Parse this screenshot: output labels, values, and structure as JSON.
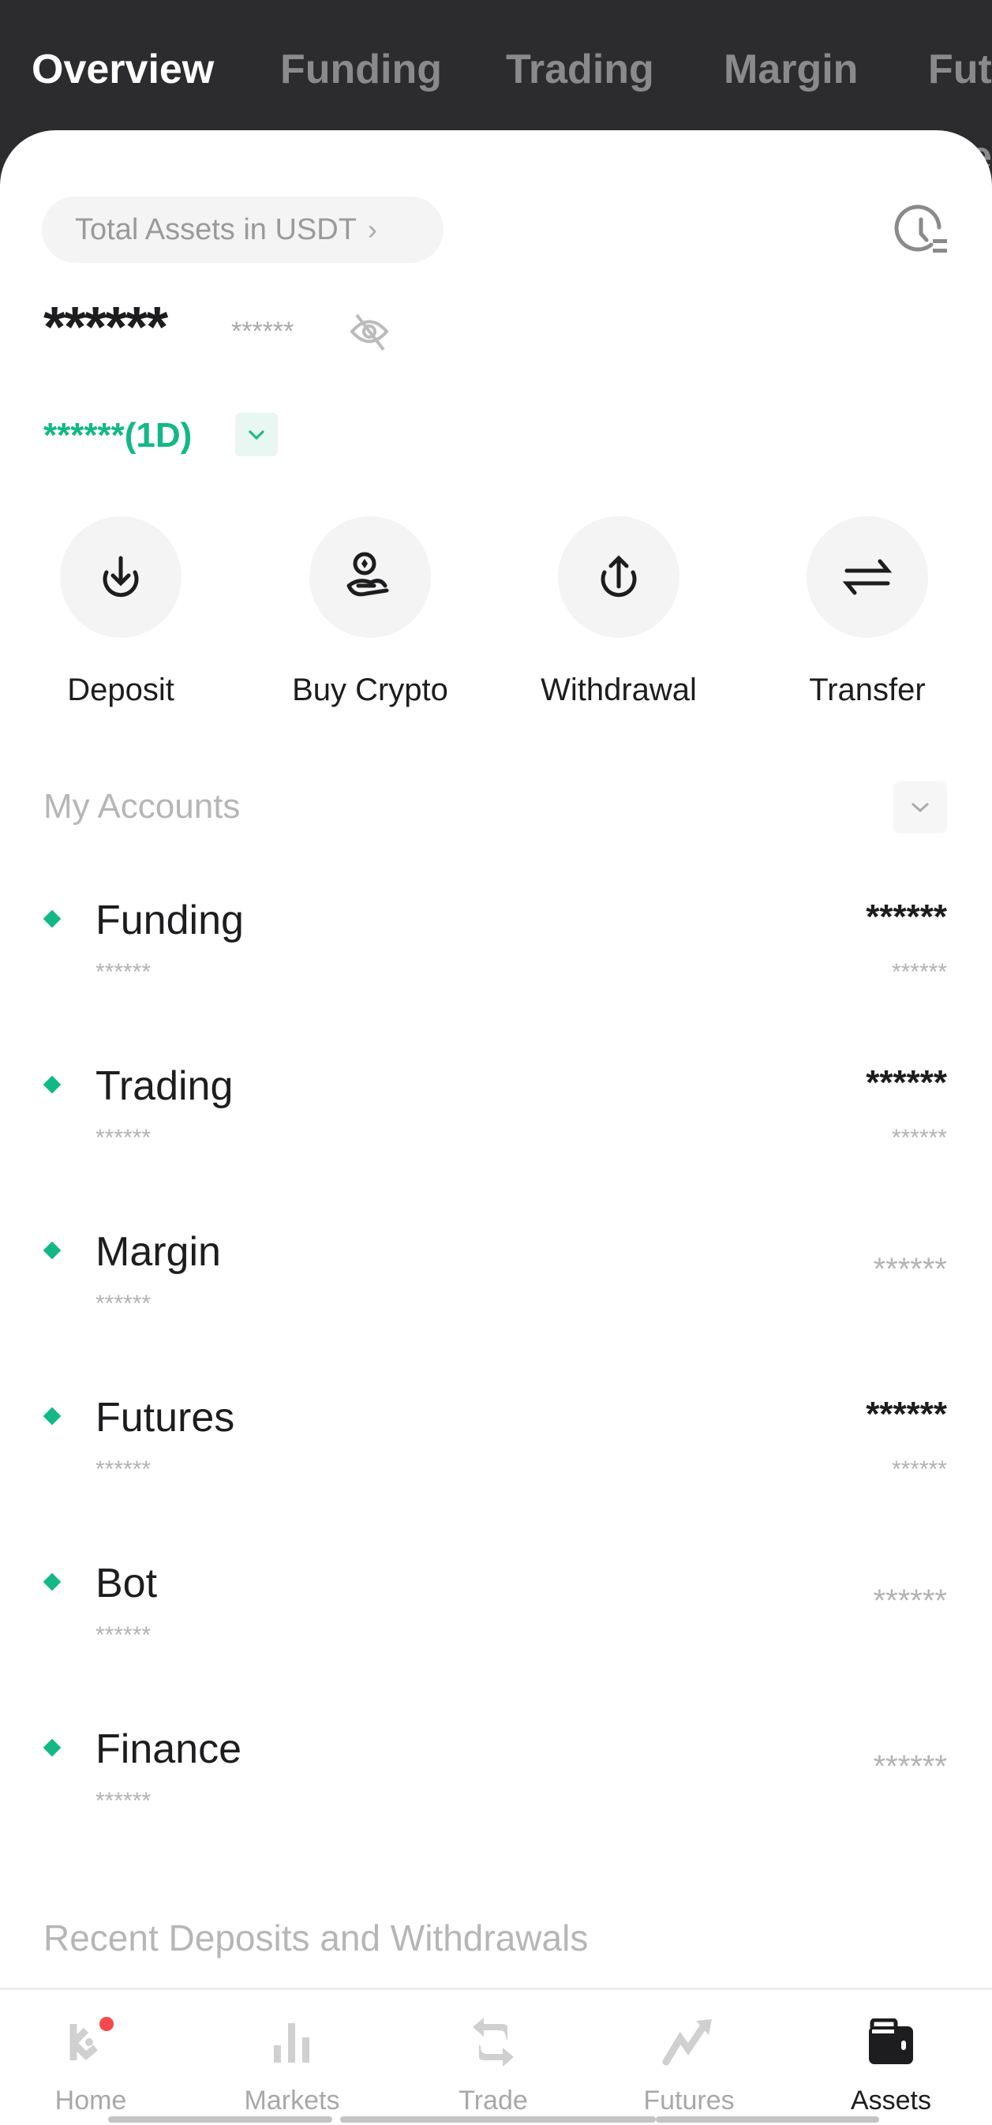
{
  "tabs": [
    "Overview",
    "Funding",
    "Trading",
    "Margin",
    "Futures"
  ],
  "total": {
    "label": "Total Assets in USDT",
    "value": "******",
    "sub_value": "******",
    "change": "******(1D)"
  },
  "actions": [
    {
      "label": "Deposit",
      "icon": "download-icon"
    },
    {
      "label": "Buy Crypto",
      "icon": "coin-hand-icon"
    },
    {
      "label": "Withdrawal",
      "icon": "upload-icon"
    },
    {
      "label": "Transfer",
      "icon": "transfer-icon"
    }
  ],
  "my_accounts": {
    "title": "My Accounts",
    "items": [
      {
        "name": "Funding",
        "sub": "******",
        "value": "******",
        "value_sub": "******"
      },
      {
        "name": "Trading",
        "sub": "******",
        "value": "******",
        "value_sub": "******"
      },
      {
        "name": "Margin",
        "sub": "******",
        "value_sub": "******"
      },
      {
        "name": "Futures",
        "sub": "******",
        "value": "******",
        "value_sub": "******"
      },
      {
        "name": "Bot",
        "sub": "******",
        "value_sub": "******"
      },
      {
        "name": "Finance",
        "sub": "******",
        "value_sub": "******"
      }
    ]
  },
  "recent_title": "Recent Deposits and Withdrawals",
  "nav": [
    "Home",
    "Markets",
    "Trade",
    "Futures",
    "Assets"
  ],
  "colors": {
    "accent": "#12b886",
    "header": "#2c2c2e",
    "badge": "#f5484d"
  }
}
